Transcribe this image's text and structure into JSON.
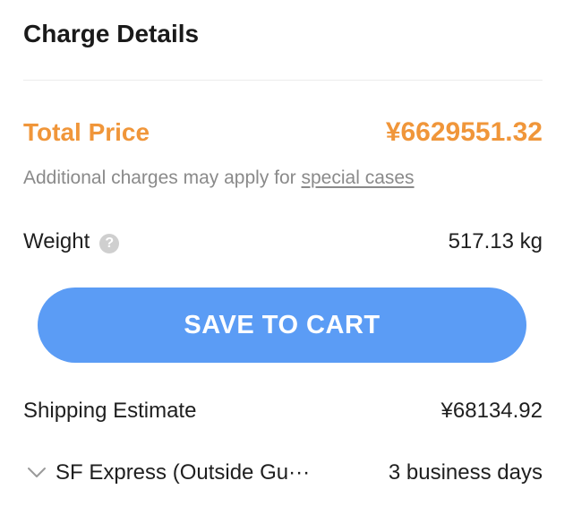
{
  "header": {
    "title": "Charge Details"
  },
  "total": {
    "label": "Total Price",
    "value": "¥6629551.32"
  },
  "note": {
    "text": "Additional charges may apply for ",
    "link": "special cases"
  },
  "weight": {
    "label": "Weight",
    "help_icon": "?",
    "value": "517.13 kg"
  },
  "actions": {
    "save_label": "SAVE TO CART"
  },
  "shipping": {
    "label": "Shipping Estimate",
    "value": "¥68134.92",
    "method": "SF Express (Outside Gu···",
    "eta": "3 business days"
  },
  "colors": {
    "accent_orange": "#f0963a",
    "button_blue": "#5b9cf5",
    "muted_text": "#8a8a8a"
  },
  "icons": {
    "help": "question-circle-icon",
    "expand": "chevron-down-icon"
  }
}
